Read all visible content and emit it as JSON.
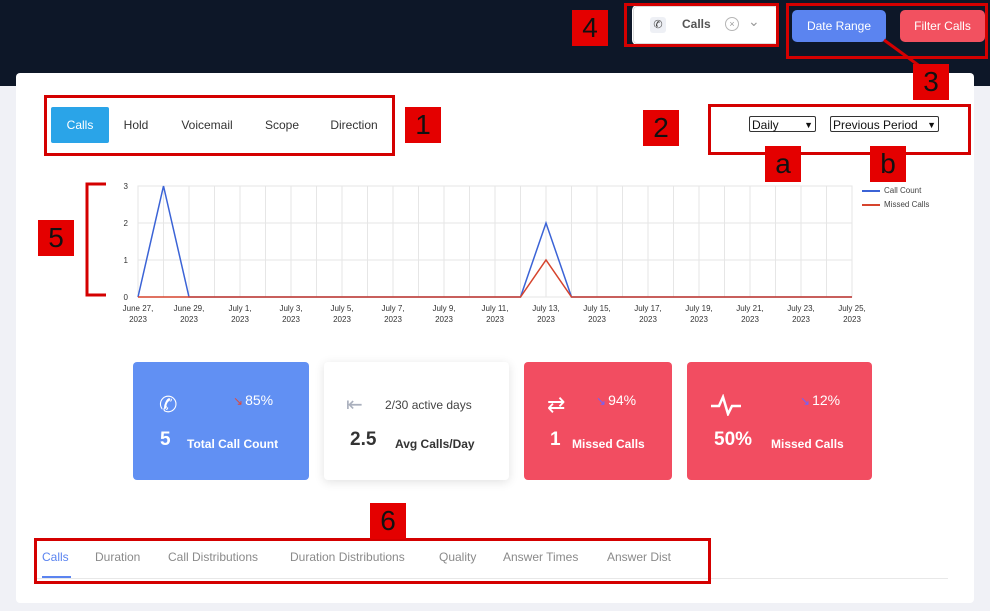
{
  "header": {
    "filter_select": {
      "icon": "phone-icon",
      "value": "Calls"
    },
    "date_range_label": "Date Range",
    "filter_calls_label": "Filter Calls"
  },
  "tabs": [
    "Calls",
    "Hold",
    "Voicemail",
    "Scope",
    "Direction"
  ],
  "period_select": "Daily",
  "compare_select": "Previous Period",
  "chart_data": {
    "type": "line",
    "x": [
      "June 27, 2023",
      "June 28, 2023",
      "June 29, 2023",
      "June 30, 2023",
      "July 1, 2023",
      "July 2, 2023",
      "July 3, 2023",
      "July 4, 2023",
      "July 5, 2023",
      "July 6, 2023",
      "July 7, 2023",
      "July 8, 2023",
      "July 9, 2023",
      "July 10, 2023",
      "July 11, 2023",
      "July 12, 2023",
      "July 13, 2023",
      "July 14, 2023",
      "July 15, 2023",
      "July 16, 2023",
      "July 17, 2023",
      "July 18, 2023",
      "July 19, 2023",
      "July 20, 2023",
      "July 21, 2023",
      "July 22, 2023",
      "July 23, 2023",
      "July 24, 2023",
      "July 25, 2023"
    ],
    "tick_labels": [
      [
        "June 27,",
        "2023"
      ],
      [
        "June 29,",
        "2023"
      ],
      [
        "July 1,",
        "2023"
      ],
      [
        "July 3,",
        "2023"
      ],
      [
        "July 5,",
        "2023"
      ],
      [
        "July 7,",
        "2023"
      ],
      [
        "July 9,",
        "2023"
      ],
      [
        "July 11,",
        "2023"
      ],
      [
        "July 13,",
        "2023"
      ],
      [
        "July 15,",
        "2023"
      ],
      [
        "July 17,",
        "2023"
      ],
      [
        "July 19,",
        "2023"
      ],
      [
        "July 21,",
        "2023"
      ],
      [
        "July 23,",
        "2023"
      ],
      [
        "July 25,",
        "2023"
      ]
    ],
    "y_ticks": [
      "0",
      "1",
      "2",
      "3"
    ],
    "ylim": [
      0,
      3
    ],
    "grid": true,
    "legend_position": "right",
    "series": [
      {
        "name": "Call Count",
        "color": "#3b63d6",
        "values": [
          0,
          3,
          0,
          0,
          0,
          0,
          0,
          0,
          0,
          0,
          0,
          0,
          0,
          0,
          0,
          0,
          2,
          0,
          0,
          0,
          0,
          0,
          0,
          0,
          0,
          0,
          0,
          0,
          0
        ]
      },
      {
        "name": "Missed Calls",
        "color": "#d6442d",
        "values": [
          0,
          0,
          0,
          0,
          0,
          0,
          0,
          0,
          0,
          0,
          0,
          0,
          0,
          0,
          0,
          0,
          1,
          0,
          0,
          0,
          0,
          0,
          0,
          0,
          0,
          0,
          0,
          0,
          0
        ]
      }
    ]
  },
  "stats": [
    {
      "icon": "phone-icon",
      "trend_icon": "trend-down-icon",
      "trend": "85%",
      "value": "5",
      "label": "Total Call Count"
    },
    {
      "icon": "arrow-left-bar-icon",
      "subtitle": "2/30 active days",
      "value": "2.5",
      "label": "Avg Calls/Day"
    },
    {
      "icon": "swap-arrows-icon",
      "trend_icon": "trend-down-icon",
      "trend": "94%",
      "value": "1",
      "label": "Missed Calls"
    },
    {
      "icon": "pulse-icon",
      "trend_icon": "trend-down-icon",
      "trend": "12%",
      "value": "50%",
      "label": "Missed Calls"
    }
  ],
  "bottom_tabs": [
    "Calls",
    "Duration",
    "Call Distributions",
    "Duration Distributions",
    "Quality",
    "Answer Times",
    "Answer Dist"
  ],
  "annotations": [
    "1",
    "2",
    "a",
    "b",
    "3",
    "4",
    "5",
    "6"
  ],
  "colors": {
    "accent": "#2aa4e8",
    "primary": "#5b84f0",
    "danger": "#f24d61",
    "header_bg": "#0d1728",
    "annotation": "#e40000"
  }
}
